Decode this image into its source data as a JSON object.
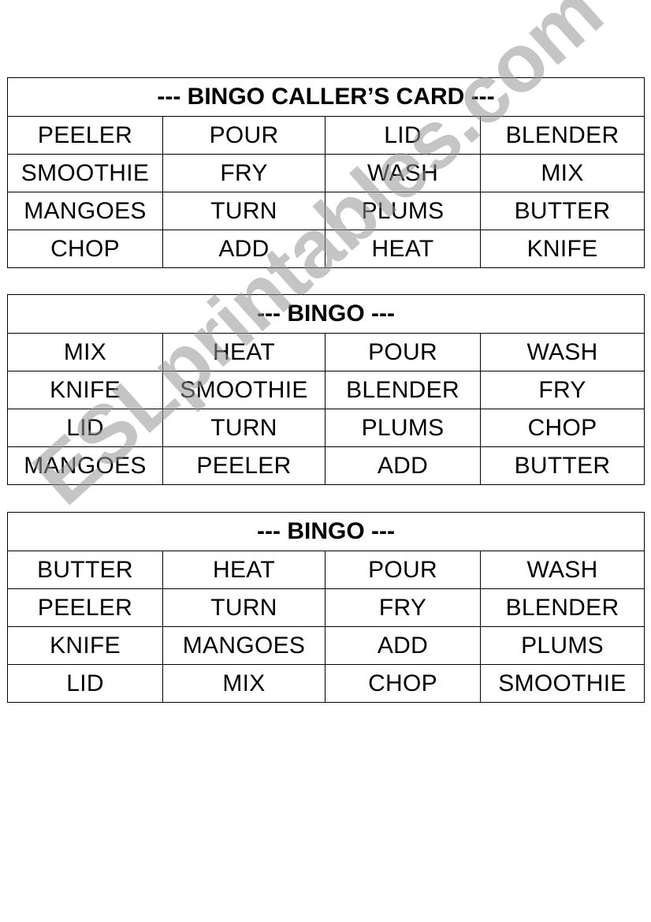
{
  "cards": [
    {
      "title": "--- BINGO CALLER’S CARD ---",
      "rows": [
        [
          "PEELER",
          "POUR",
          "LID",
          "BLENDER"
        ],
        [
          "SMOOTHIE",
          "FRY",
          "WASH",
          "MIX"
        ],
        [
          "MANGOES",
          "TURN",
          "PLUMS",
          "BUTTER"
        ],
        [
          "CHOP",
          "ADD",
          "HEAT",
          "KNIFE"
        ]
      ]
    },
    {
      "title": "--- BINGO ---",
      "rows": [
        [
          "MIX",
          "HEAT",
          "POUR",
          "WASH"
        ],
        [
          "KNIFE",
          "SMOOTHIE",
          "BLENDER",
          "FRY"
        ],
        [
          "LID",
          "TURN",
          "PLUMS",
          "CHOP"
        ],
        [
          "MANGOES",
          "PEELER",
          "ADD",
          "BUTTER"
        ]
      ]
    },
    {
      "title": "--- BINGO ---",
      "rows": [
        [
          "BUTTER",
          "HEAT",
          "POUR",
          "WASH"
        ],
        [
          "PEELER",
          "TURN",
          "FRY",
          "BLENDER"
        ],
        [
          "KNIFE",
          "MANGOES",
          "ADD",
          "PLUMS"
        ],
        [
          "LID",
          "MIX",
          "CHOP",
          "SMOOTHIE"
        ]
      ]
    }
  ],
  "watermark": "ESLprintables.com"
}
